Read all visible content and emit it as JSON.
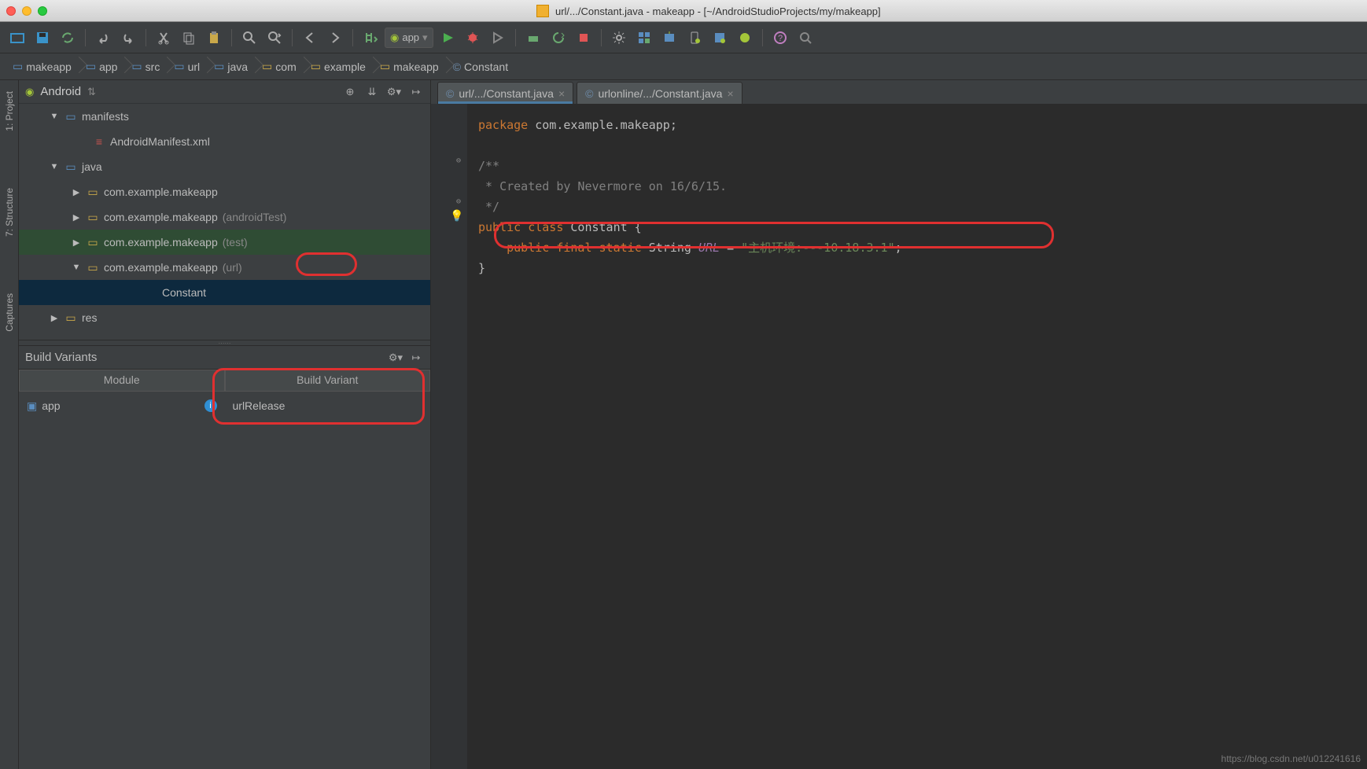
{
  "title": "url/.../Constant.java - makeapp - [~/AndroidStudioProjects/my/makeapp]",
  "breadcrumbs": [
    "makeapp",
    "app",
    "src",
    "url",
    "java",
    "com",
    "example",
    "makeapp",
    "Constant"
  ],
  "run_config": "app",
  "sidebar": {
    "header": "Android",
    "tree": {
      "manifests": "manifests",
      "manifest_file": "AndroidManifest.xml",
      "java": "java",
      "pkg_main": "com.example.makeapp",
      "pkg_test": "com.example.makeapp",
      "pkg_test_suffix": "(androidTest)",
      "pkg_unit": "com.example.makeapp",
      "pkg_unit_suffix": "(test)",
      "pkg_url": "com.example.makeapp",
      "pkg_url_suffix": "(url)",
      "constant": "Constant",
      "res": "res"
    }
  },
  "variants": {
    "title": "Build Variants",
    "col_module": "Module",
    "col_variant": "Build Variant",
    "module": "app",
    "variant": "urlRelease"
  },
  "tabs": [
    {
      "label": "url/.../Constant.java",
      "active": true
    },
    {
      "label": "urlonline/.../Constant.java",
      "active": false
    }
  ],
  "code": {
    "package_kw": "package",
    "package_name": "com.example.makeapp",
    "comment_open": "/**",
    "comment_body": " * Created by Nevermore on 16/6/15.",
    "comment_close": " */",
    "public": "public",
    "class": "class",
    "class_name": "Constant",
    "final": "final",
    "static": "static",
    "string_type": "String",
    "url_field": "URL",
    "url_value": "\"主机环境:---10.18.3.1\""
  },
  "gutter_labels": {
    "project": "1: Project",
    "structure": "7: Structure",
    "captures": "Captures"
  },
  "watermark": "https://blog.csdn.net/u012241616"
}
